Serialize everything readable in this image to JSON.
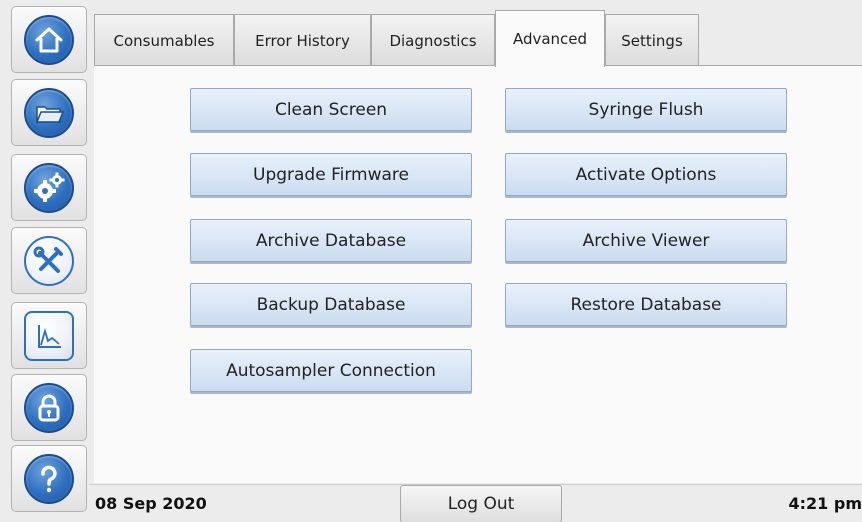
{
  "sidebar": {
    "items": [
      {
        "name": "home-icon"
      },
      {
        "name": "folder-icon"
      },
      {
        "name": "gears-icon"
      },
      {
        "name": "tools-icon"
      },
      {
        "name": "graph-icon"
      },
      {
        "name": "lock-icon"
      },
      {
        "name": "help-icon"
      }
    ]
  },
  "tabs": [
    {
      "label": "Consumables"
    },
    {
      "label": "Error History"
    },
    {
      "label": "Diagnostics"
    },
    {
      "label": "Advanced",
      "active": true
    },
    {
      "label": "Settings"
    }
  ],
  "advanced": {
    "buttons": [
      {
        "label": "Clean Screen"
      },
      {
        "label": "Syringe Flush"
      },
      {
        "label": "Upgrade Firmware"
      },
      {
        "label": "Activate Options"
      },
      {
        "label": "Archive Database"
      },
      {
        "label": "Archive Viewer"
      },
      {
        "label": "Backup Database"
      },
      {
        "label": "Restore Database"
      },
      {
        "label": "Autosampler Connection"
      }
    ]
  },
  "status": {
    "date": "08 Sep 2020",
    "logout_label": "Log Out",
    "time": "4:21 pm"
  },
  "colors": {
    "accent_blue": "#2e6fc0",
    "button_blue": "#cbdcf0"
  }
}
